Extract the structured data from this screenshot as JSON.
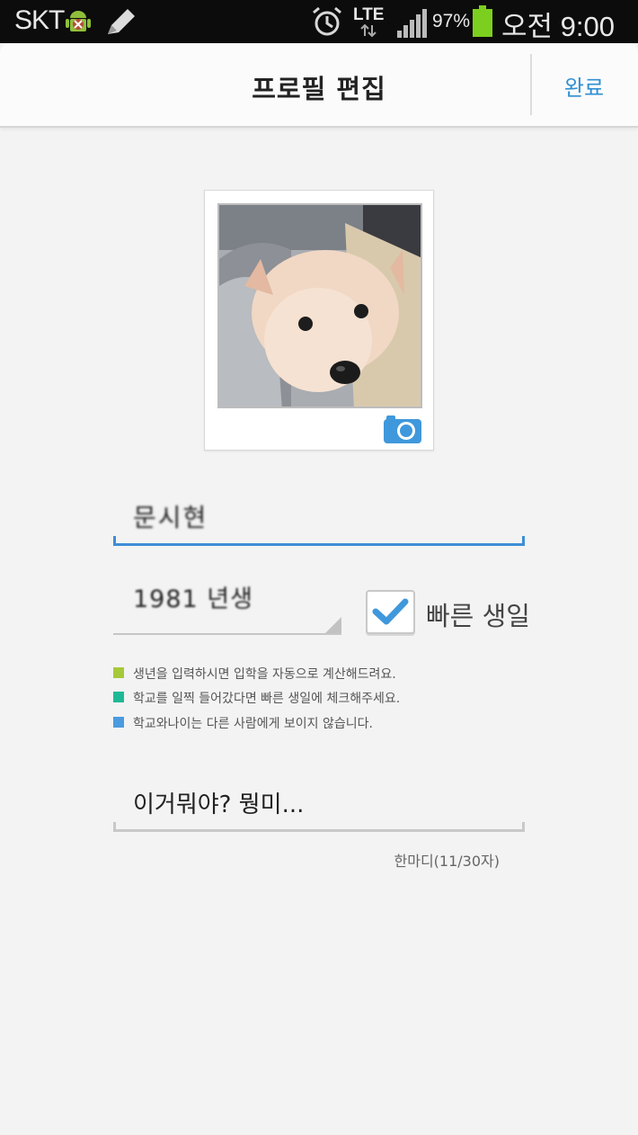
{
  "status_bar": {
    "carrier": "SKT",
    "network": "LTE",
    "battery": "97%",
    "time": "오전 9:00",
    "icons": [
      "android-debug-icon",
      "pencil-icon",
      "alarm-icon",
      "lte-arrows-icon",
      "signal-icon",
      "battery-icon"
    ]
  },
  "header": {
    "title": "프로필 편집",
    "done_label": "완료"
  },
  "profile": {
    "name": "문시현",
    "birth_year": "1981 년생",
    "fast_birthday_label": "빠른 생일",
    "fast_birthday_checked": true
  },
  "notes": [
    {
      "text": "생년을 입력하시면 입학을 자동으로 계산해드려요.",
      "color": "#a6c93a"
    },
    {
      "text": "학교를 일찍 들어갔다면 빠른 생일에 체크해주세요.",
      "color": "#1fb896"
    },
    {
      "text": "학교와나이는 다른 사람에게 보이지 않습니다.",
      "color": "#4a9be0"
    }
  ],
  "status_message": {
    "value": "이거뭐야? 뭥미...",
    "counter": "한마디(11/30자)"
  },
  "colors": {
    "accent": "#3e8ed6",
    "done": "#2f8fd3",
    "battery": "#7ccf1f"
  }
}
